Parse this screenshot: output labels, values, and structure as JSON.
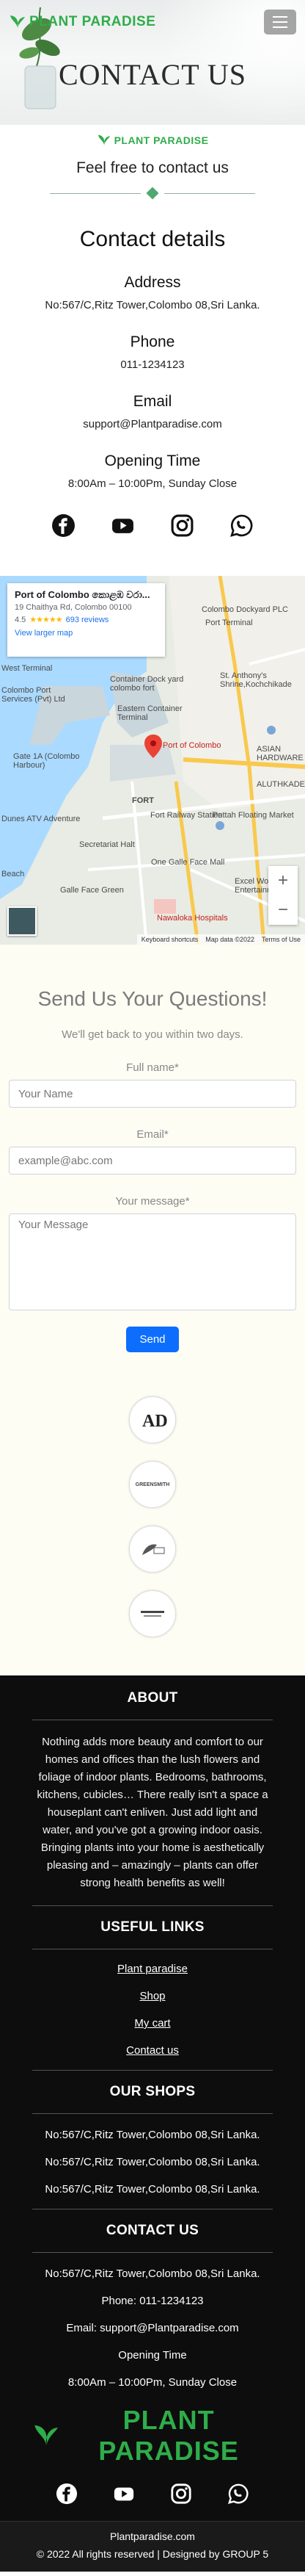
{
  "brand": {
    "name": "PLANT PARADISE",
    "color": "#2ead4a"
  },
  "hero": {
    "title": "CONTACT US"
  },
  "intro": {
    "logo": "PLANT PARADISE",
    "subtitle": "Feel free to contact us"
  },
  "details": {
    "heading": "Contact details",
    "address_label": "Address",
    "address": "No:567/C,Ritz Tower,Colombo 08,Sri Lanka.",
    "phone_label": "Phone",
    "phone": "011-1234123",
    "email_label": "Email",
    "email": "support@Plantparadise.com",
    "hours_label": "Opening Time",
    "hours": "8:00Am – 10:00Pm, Sunday Close"
  },
  "socials": [
    "facebook-icon",
    "youtube-icon",
    "instagram-icon",
    "whatsapp-icon"
  ],
  "map": {
    "place_name": "Port of Colombo කොළඹ වරා...",
    "place_address": "19 Chaithya Rd, Colombo 00100",
    "rating": "4.5",
    "stars": "★★★★★",
    "reviews": "693 reviews",
    "larger_map": "View larger map",
    "pin_label": "Port of Colombo",
    "labels": [
      {
        "text": "Colombo Dockyard PLC"
      },
      {
        "text": "Port Terminal"
      },
      {
        "text": "West Terminal"
      },
      {
        "text": "Colombo Port Services (Pvt) Ltd"
      },
      {
        "text": "Container Dock yard colombo fort"
      },
      {
        "text": "Eastern Container Terminal"
      },
      {
        "text": "St. Anthony's Shrine,Kochchikade"
      },
      {
        "text": "ASIAN HARDWARE"
      },
      {
        "text": "ALUTHKADE"
      },
      {
        "text": "Gate 1A (Colombo Harbour)"
      },
      {
        "text": "FORT"
      },
      {
        "text": "Fort Railway Station"
      },
      {
        "text": "Pettah Floating Market"
      },
      {
        "text": "Dunes ATV Adventure"
      },
      {
        "text": "Secretariat Halt"
      },
      {
        "text": "One Galle Face Mall"
      },
      {
        "text": "Galle Face Green"
      },
      {
        "text": "Nawaloka Hospitals"
      },
      {
        "text": "Beach"
      },
      {
        "text": "Excel World Entertainment"
      }
    ],
    "zoom_in": "+",
    "zoom_out": "−",
    "footer": [
      "Keyboard shortcuts",
      "Map data ©2022",
      "Terms of Use"
    ]
  },
  "form": {
    "heading": "Send Us Your Questions!",
    "subheading": "We'll get back to you within two days.",
    "name_label": "Full name*",
    "name_placeholder": "Your Name",
    "email_label": "Email*",
    "email_placeholder": "example@abc.com",
    "message_label": "Your message*",
    "message_placeholder": "Your Message",
    "submit": "Send"
  },
  "brand_logos": [
    "AD",
    "GREENSMITH",
    "",
    ""
  ],
  "footer": {
    "about_heading": "ABOUT",
    "about_text": "Nothing adds more beauty and comfort to our homes and offices than the lush flowers and foliage of indoor plants. Bedrooms, bathrooms, kitchens, cubicles… There really isn't a space a houseplant can't enliven. Just add light and water, and you've got a growing indoor oasis. Bringing plants into your home is aesthetically pleasing and – amazingly – plants can offer strong health benefits as well!",
    "links_heading": "USEFUL LINKS",
    "links": [
      "Plant paradise",
      "Shop",
      "My cart",
      "Contact us"
    ],
    "shops_heading": "OUR SHOPS",
    "shops": [
      "No:567/C,Ritz Tower,Colombo 08,Sri Lanka.",
      "No:567/C,Ritz Tower,Colombo 08,Sri Lanka.",
      "No:567/C,Ritz Tower,Colombo 08,Sri Lanka."
    ],
    "contact_heading": "CONTACT US",
    "contact_address": "No:567/C,Ritz Tower,Colombo 08,Sri Lanka.",
    "contact_phone": "Phone: 011-1234123",
    "contact_email": "Email: support@Plantparadise.com",
    "contact_hours_label": "Opening Time",
    "contact_hours": "8:00Am – 10:00Pm, Sunday Close",
    "logo": "PLANT PARADISE",
    "site": "Plantparadise.com",
    "copyright": "© 2022 All rights reserved | Designed by GROUP 5"
  }
}
